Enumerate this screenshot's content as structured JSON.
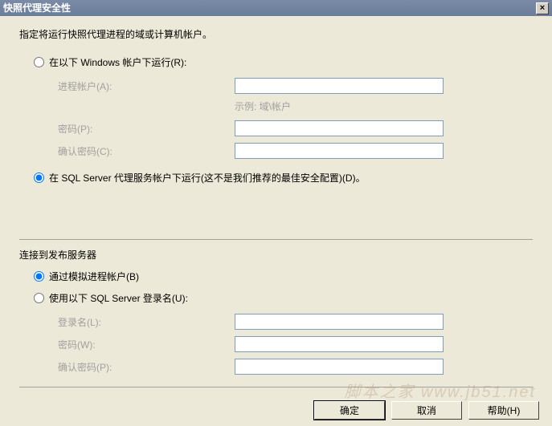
{
  "title": "快照代理安全性",
  "instruction": "指定将运行快照代理进程的域或计算机帐户。",
  "runas": {
    "windows_radio": "在以下 Windows 帐户下运行(R):",
    "process_account_label": "进程帐户(A):",
    "example_hint": "示例: 域\\帐户",
    "password_label": "密码(P):",
    "confirm_password_label": "确认密码(C):",
    "sqlagent_radio": "在 SQL Server 代理服务帐户下运行(这不是我们推荐的最佳安全配置)(D)。",
    "selected": "sqlagent"
  },
  "connect": {
    "section_title": "连接到发布服务器",
    "impersonate_radio": "通过模拟进程帐户(B)",
    "sqllogin_radio": "使用以下 SQL Server 登录名(U):",
    "login_label": "登录名(L):",
    "password_label": "密码(W):",
    "confirm_password_label": "确认密码(P):",
    "selected": "impersonate"
  },
  "buttons": {
    "ok": "确定",
    "cancel": "取消",
    "help": "帮助(H)"
  },
  "watermark": "脚本之家 www.jb51.net"
}
